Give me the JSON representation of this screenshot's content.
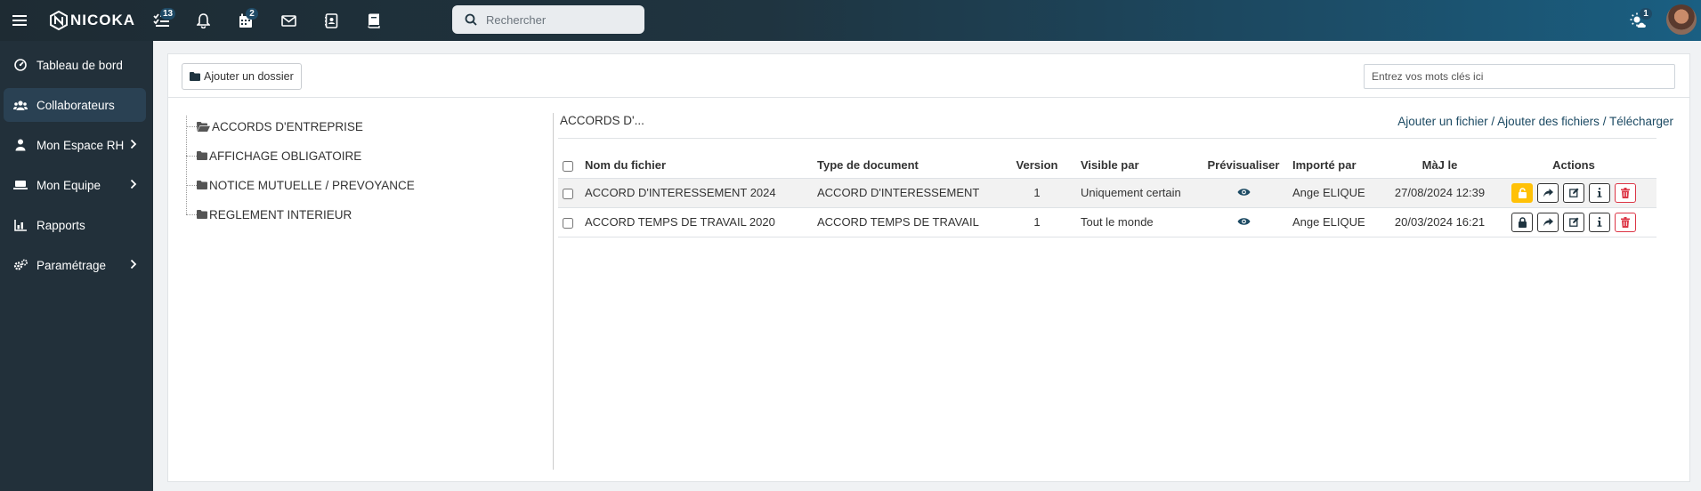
{
  "topbar": {
    "brand": "NICOKA",
    "tasks_badge": "13",
    "calendar_badge": "2",
    "weather_badge": "1",
    "search_placeholder": "Rechercher"
  },
  "sidebar": {
    "items": [
      {
        "label": "Tableau de bord",
        "icon": "dashboard-icon",
        "active": false,
        "has_children": false
      },
      {
        "label": "Collaborateurs",
        "icon": "users-icon",
        "active": true,
        "has_children": false
      },
      {
        "label": "Mon Espace RH",
        "icon": "user-icon",
        "active": false,
        "has_children": true
      },
      {
        "label": "Mon Equipe",
        "icon": "team-icon",
        "active": false,
        "has_children": true
      },
      {
        "label": "Rapports",
        "icon": "chart-icon",
        "active": false,
        "has_children": false
      },
      {
        "label": "Paramétrage",
        "icon": "cogs-icon",
        "active": false,
        "has_children": true
      }
    ]
  },
  "toolbar": {
    "add_folder_label": "Ajouter un dossier",
    "keywords_placeholder": "Entrez vos mots clés ici"
  },
  "tree": {
    "folders": [
      {
        "label": "ACCORDS D'ENTREPRISE",
        "open": true
      },
      {
        "label": "AFFICHAGE OBLIGATOIRE",
        "open": false
      },
      {
        "label": "NOTICE MUTUELLE / PREVOYANCE",
        "open": false
      },
      {
        "label": "REGLEMENT INTERIEUR",
        "open": false
      }
    ]
  },
  "panel": {
    "breadcrumb": "ACCORDS D'...",
    "links": {
      "add_file": "Ajouter un fichier",
      "add_files": "Ajouter des fichiers",
      "download": "Télécharger",
      "separator": " / "
    }
  },
  "table": {
    "headers": {
      "name": "Nom du fichier",
      "type": "Type de document",
      "version": "Version",
      "visible": "Visible par",
      "preview": "Prévisualiser",
      "imported": "Importé par",
      "updated": "MàJ le",
      "actions": "Actions"
    },
    "rows": [
      {
        "name": "ACCORD D'INTERESSEMENT 2024",
        "type": "ACCORD D'INTERESSEMENT",
        "version": "1",
        "visible": "Uniquement certain",
        "imported": "Ange ELIQUE",
        "updated": "27/08/2024 12:39",
        "locked": true
      },
      {
        "name": "ACCORD TEMPS DE TRAVAIL 2020",
        "type": "ACCORD TEMPS DE TRAVAIL",
        "version": "1",
        "visible": "Tout le monde",
        "imported": "Ange ELIQUE",
        "updated": "20/03/2024 16:21",
        "locked": false
      }
    ]
  },
  "colors": {
    "accent": "#1c4a63",
    "sidebar": "#22303a",
    "warning": "#ffc107",
    "danger": "#dc3545"
  }
}
